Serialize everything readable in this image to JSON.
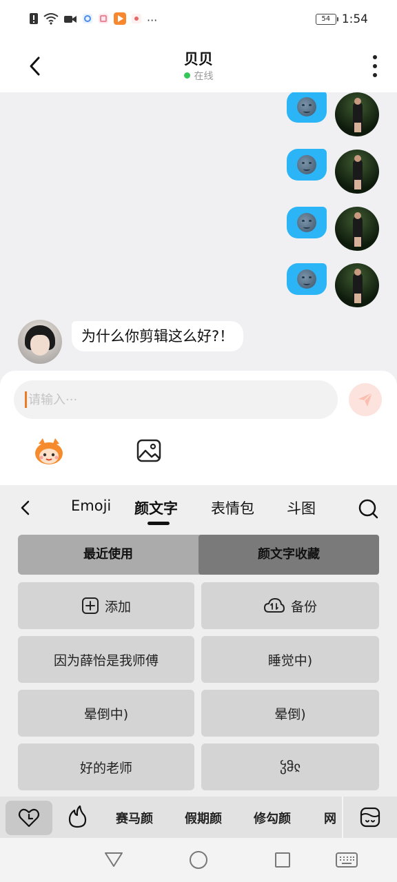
{
  "status_bar": {
    "battery": "54",
    "time": "1:54",
    "more": "···"
  },
  "header": {
    "title": "贝贝",
    "status": "在线"
  },
  "chat": {
    "incoming_text": "为什么你剪辑这么好?！"
  },
  "input": {
    "placeholder": "请输入···"
  },
  "kaomoji_panel": {
    "tabs": [
      "Emoji",
      "颜文字",
      "表情包",
      "斗图"
    ],
    "active_tab": "颜文字",
    "segments": [
      "最近使用",
      "颜文字收藏"
    ],
    "active_segment": "颜文字收藏",
    "add_label": "添加",
    "backup_label": "备份",
    "items": [
      "因为薛怡是我师傅",
      "睡觉中)",
      "晕倒中)",
      "晕倒)",
      "好的老师",
      "ჴჵჺ"
    ],
    "categories": [
      "赛马颜",
      "假期颜",
      "修勾颜",
      "网"
    ]
  },
  "colors": {
    "bubble_blue": "#2bb5f7",
    "online_green": "#34c759",
    "caret_orange": "#f07a1f",
    "send_bg": "#fde3dd"
  }
}
